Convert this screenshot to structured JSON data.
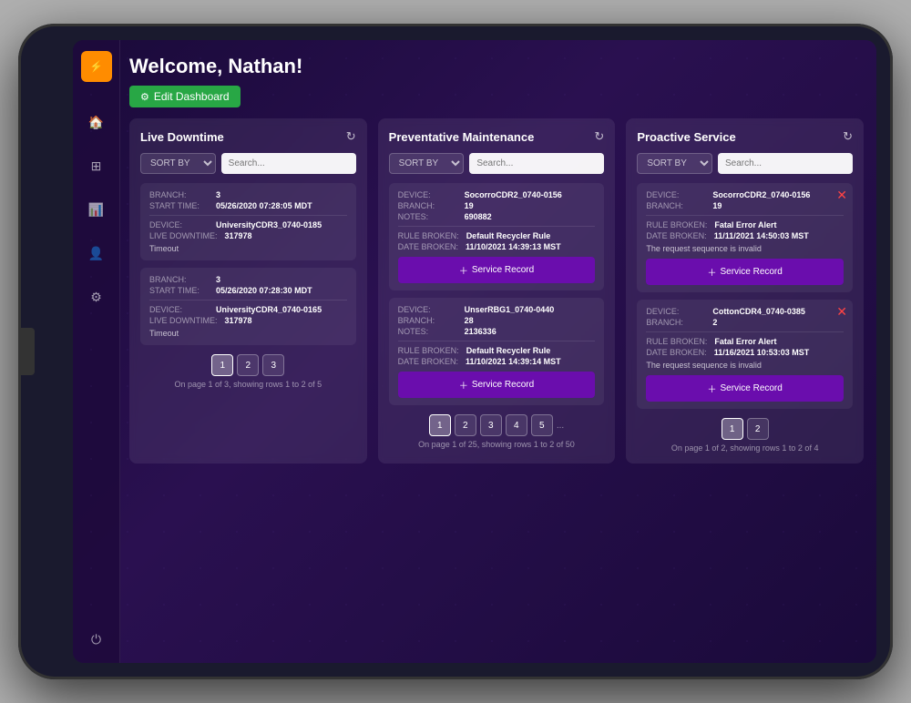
{
  "app": {
    "welcome": "Welcome, Nathan!",
    "edit_dashboard": "Edit Dashboard"
  },
  "sidebar": {
    "icons": [
      "🏠",
      "📊",
      "📈",
      "👤",
      "⚙",
      "⏻"
    ]
  },
  "panels": {
    "live_downtime": {
      "title": "Live Downtime",
      "sort_label": "SORT BY",
      "search_placeholder": "Search...",
      "records": [
        {
          "branch_label": "BRANCH:",
          "branch_value": "3",
          "start_time_label": "START TIME:",
          "start_time_value": "05/26/2020 07:28:05 MDT",
          "device_label": "DEVICE:",
          "device_value": "UniversityCDR3_0740-0185",
          "live_downtime_label": "LIVE DOWNTIME:",
          "live_downtime_value": "317978",
          "note": "Timeout"
        },
        {
          "branch_label": "BRANCH:",
          "branch_value": "3",
          "start_time_label": "START TIME:",
          "start_time_value": "05/26/2020 07:28:30 MDT",
          "device_label": "DEVICE:",
          "device_value": "UniversityCDR4_0740-0165",
          "live_downtime_label": "LIVE DOWNTIME:",
          "live_downtime_value": "317978",
          "note": "Timeout"
        }
      ],
      "pagination": {
        "current": 1,
        "pages": [
          1,
          2,
          3
        ],
        "info": "On page 1 of 3, showing rows 1 to 2 of 5"
      }
    },
    "preventative_maintenance": {
      "title": "Preventative Maintenance",
      "sort_label": "SORT BY",
      "search_placeholder": "Search...",
      "records": [
        {
          "device_label": "DEVICE:",
          "device_value": "SocorroCDR2_0740-0156",
          "branch_label": "BRANCH:",
          "branch_value": "19",
          "notes_label": "NOTES:",
          "notes_value": "690882",
          "rule_broken_label": "RULE BROKEN:",
          "rule_broken_value": "Default Recycler Rule",
          "date_broken_label": "DATE BROKEN:",
          "date_broken_value": "11/10/2021 14:39:13 MST",
          "service_btn": "Service Record"
        },
        {
          "device_label": "DEVICE:",
          "device_value": "UnserRBG1_0740-0440",
          "branch_label": "BRANCH:",
          "branch_value": "28",
          "notes_label": "NOTES:",
          "notes_value": "2136336",
          "rule_broken_label": "RULE BROKEN:",
          "rule_broken_value": "Default Recycler Rule",
          "date_broken_label": "DATE BROKEN:",
          "date_broken_value": "11/10/2021 14:39:14 MST",
          "service_btn": "Service Record"
        }
      ],
      "pagination": {
        "current": 1,
        "pages": [
          1,
          2,
          3,
          4,
          5
        ],
        "has_more": true,
        "info": "On page 1 of 25, showing rows 1 to 2 of 50"
      }
    },
    "proactive_service": {
      "title": "Proactive Service",
      "sort_label": "SORT BY",
      "search_placeholder": "Search...",
      "records": [
        {
          "device_label": "DEVICE:",
          "device_value": "SocorroCDR2_0740-0156",
          "branch_label": "BRANCH:",
          "branch_value": "19",
          "rule_broken_label": "RULE BROKEN:",
          "rule_broken_value": "Fatal Error Alert",
          "date_broken_label": "DATE BROKEN:",
          "date_broken_value": "11/11/2021 14:50:03 MST",
          "note": "The request sequence is invalid",
          "service_btn": "Service Record",
          "has_close": true
        },
        {
          "device_label": "DEVICE:",
          "device_value": "CottonCDR4_0740-0385",
          "branch_label": "BRANCH:",
          "branch_value": "2",
          "rule_broken_label": "RULE BROKEN:",
          "rule_broken_value": "Fatal Error Alert",
          "date_broken_label": "DATE BROKEN:",
          "date_broken_value": "11/16/2021 10:53:03 MST",
          "note": "The request sequence is invalid",
          "service_btn": "Service Record",
          "has_close": true
        }
      ],
      "pagination": {
        "current": 1,
        "pages": [
          1,
          2
        ],
        "info": "On page 1 of 2, showing rows 1 to 2 of 4"
      }
    }
  }
}
